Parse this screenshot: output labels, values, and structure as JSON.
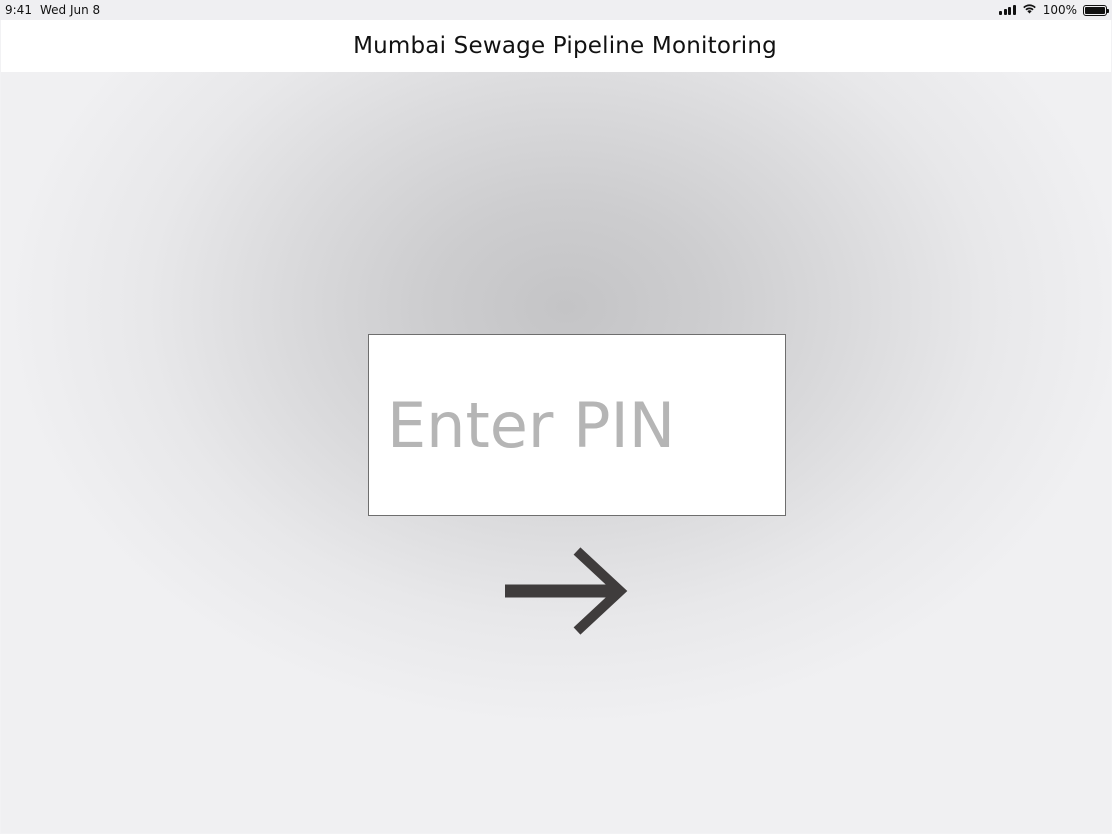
{
  "status_bar": {
    "time": "9:41",
    "date": "Wed Jun 8",
    "battery_text": "100%",
    "battery_level": 1.0,
    "icons": [
      "cellular-signal-icon",
      "wifi-icon",
      "battery-icon"
    ]
  },
  "header": {
    "title": "Mumbai Sewage Pipeline Monitoring"
  },
  "pin": {
    "placeholder": "Enter PIN",
    "value": ""
  },
  "submit": {
    "icon": "arrow-right-icon",
    "color": "#3f3c3c"
  },
  "colors": {
    "header_bg": "#ffffff",
    "background": "#efeff2",
    "gradient_center": "#c4c4c6",
    "placeholder": "#b5b5b5"
  }
}
